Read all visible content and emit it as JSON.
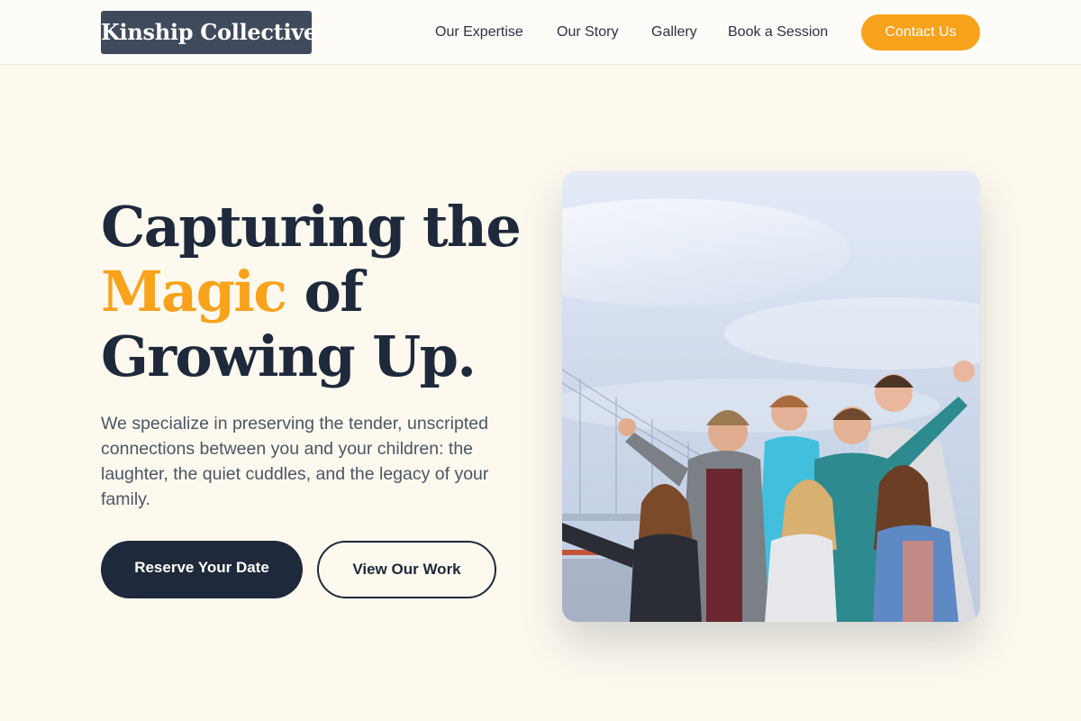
{
  "header": {
    "logo_text": "Kinship Collective",
    "nav": [
      "Our Expertise",
      "Our Story",
      "Gallery",
      "Book a Session"
    ],
    "cta_label": "Contact Us"
  },
  "hero": {
    "headline": {
      "line1": "Capturing the",
      "line2_accent": "Magic",
      "line2_rest": " of",
      "line3": "Growing Up."
    },
    "subtext": "We specialize in preserving the tender, unscripted connections between you and your children: the laughter, the quiet cuddles, and the legacy of your family.",
    "primary_button": "Reserve Your Date",
    "secondary_button": "View Our Work"
  },
  "colors": {
    "accent": "#f9a21b",
    "dark": "#1e293b",
    "background": "#fdf9ef",
    "logo_bg": "#3f4a5c"
  },
  "icons": []
}
